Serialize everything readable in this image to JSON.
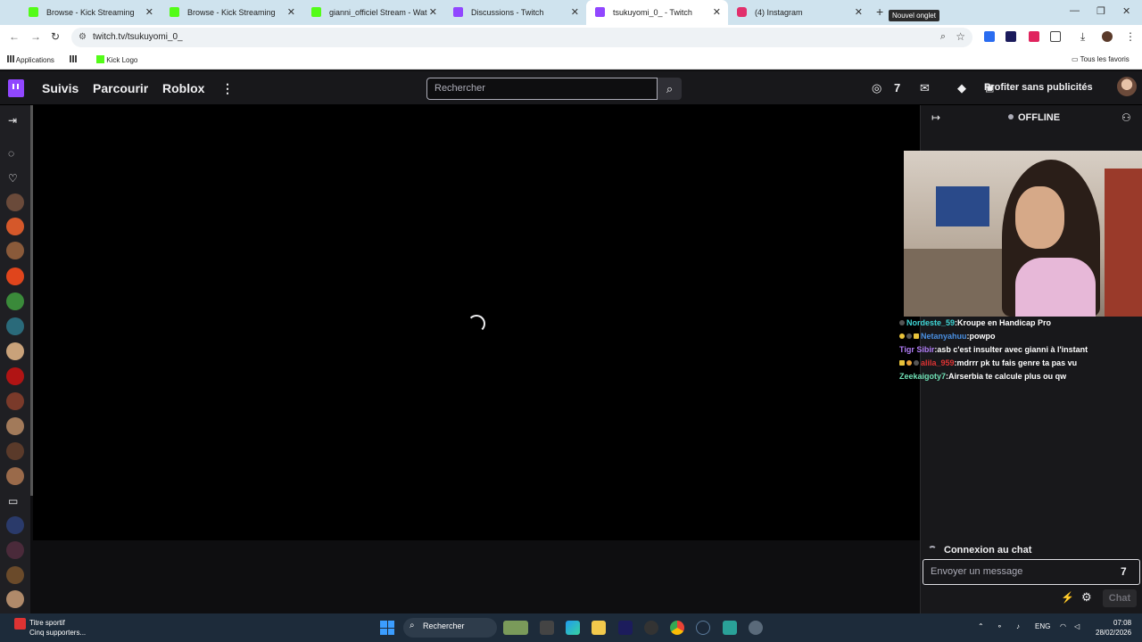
{
  "browser": {
    "tabs": [
      {
        "label": "Browse - Kick Streaming",
        "favicon_color": "#53fc18",
        "active": false
      },
      {
        "label": "Browse - Kick Streaming",
        "favicon_color": "#53fc18",
        "active": false
      },
      {
        "label": "gianni_officiel Stream - Watch L",
        "favicon_color": "#53fc18",
        "active": false
      },
      {
        "label": "Discussions - Twitch",
        "favicon_color": "#9147ff",
        "active": false
      },
      {
        "label": "tsukuyomi_0_ - Twitch",
        "favicon_color": "#9147ff",
        "active": true
      },
      {
        "label": "(4) Instagram",
        "favicon_color": "#e1306c",
        "active": false
      }
    ],
    "newtab_tooltip": "Nouvel onglet",
    "url": "twitch.tv/tsukuyomi_0_",
    "bookmarks": {
      "apps": "Applications",
      "kick_logo": "Kick Logo",
      "all_favorites": "Tous les favoris"
    }
  },
  "twitch": {
    "nav": {
      "following": "Suivis",
      "browse": "Parcourir",
      "game": "Roblox",
      "more": "⋮"
    },
    "search_placeholder": "Rechercher",
    "no_ads": "Profiter sans publicités",
    "status": "OFFLINE",
    "chat": {
      "messages": [
        {
          "user": "Nordeste_59",
          "text": "Kroupe en Handicap Pro",
          "style": "u1"
        },
        {
          "user": "Netanyahuu",
          "text": "powpo",
          "style": "u2"
        },
        {
          "user": "Tigr Sibir",
          "text": "asb c'est insulter avec gianni à l'instant",
          "style": "u3"
        },
        {
          "user": "alila_959",
          "text": "mdrrr pk tu fais genre ta pas vu",
          "style": "u4"
        },
        {
          "user": "Zeekaigoty7",
          "text": "Airserbia te calcule plus ou qw",
          "style": "u5"
        }
      ],
      "connecting": "Connexion au chat",
      "input_placeholder": "Envoyer un message",
      "send_label": "Chat"
    }
  },
  "taskbar": {
    "notification_title": "Titre sportif",
    "notification_sub": "Cinq supporters...",
    "search_label": "Rechercher",
    "lang": "ENG",
    "time": "07:08",
    "date": "28/02/2026"
  }
}
